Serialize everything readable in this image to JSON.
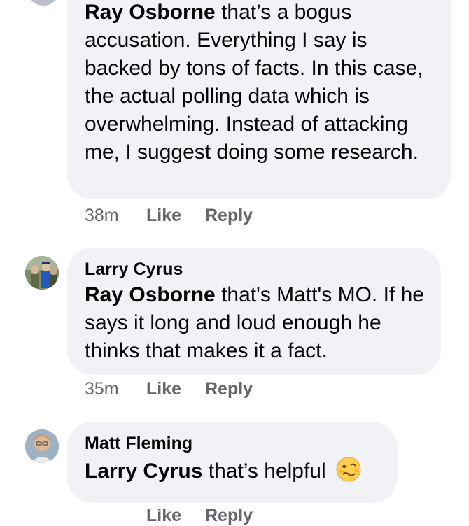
{
  "comments": [
    {
      "author": "",
      "mention": "Ray Osborne",
      "text": " that’s a bogus accusation. Everything I say is backed by tons of facts. In this case, the actual polling data which is overwhelming. Instead of attacking me, I suggest doing some research.",
      "time": "38m",
      "like_label": "Like",
      "reply_label": "Reply"
    },
    {
      "author": "Larry Cyrus",
      "mention": "Ray Osborne",
      "text": " that's Matt's MO.  If he says it long and loud enough he thinks that makes it a fact.",
      "time": "35m",
      "like_label": "Like",
      "reply_label": "Reply",
      "avatar_icon": "user-photo-graduation"
    },
    {
      "author": "Matt Fleming",
      "mention": "Larry Cyrus",
      "text": " that’s helpful ",
      "emoji": "woozy-face-emoji",
      "time": "",
      "like_label": "Like",
      "reply_label": "Reply",
      "avatar_icon": "user-photo-portrait"
    }
  ],
  "colors": {
    "bubble": "#f0f2f5",
    "meta": "#65676b",
    "text": "#050505"
  }
}
